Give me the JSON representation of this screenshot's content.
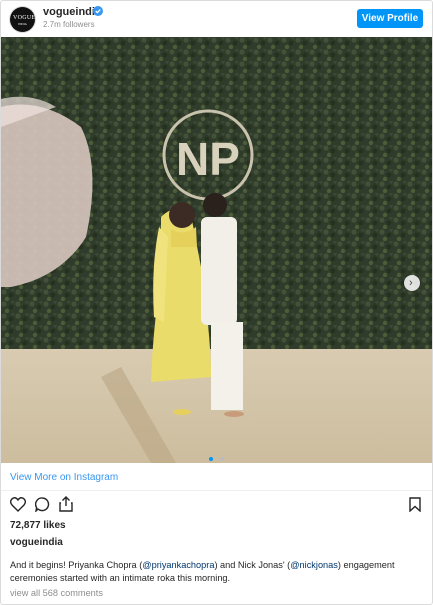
{
  "header": {
    "username": "vogueindia",
    "followers": "2.7m followers",
    "view_profile_label": "View Profile",
    "avatar_text": "VOGUE",
    "avatar_subtext": "INDIA"
  },
  "media": {
    "sign_text": "NP",
    "dots": 2,
    "active_dot": 0,
    "icons": {
      "next": "chevron-right-icon"
    }
  },
  "view_more_label": "View More on Instagram",
  "actions": {
    "icons": [
      "heart-icon",
      "comment-icon",
      "share-icon",
      "bookmark-icon"
    ]
  },
  "likes": "72,877 likes",
  "caption": {
    "username": "vogueindia",
    "text_1": "And it begins! Priyanka Chopra (",
    "mention_1": "@priyankachopra",
    "text_2": ") and Nick Jonas' (",
    "mention_2": "@nickjonas",
    "text_3": ") engagement ceremonies started with an intimate roka this morning."
  },
  "comments_label": "view all 568 comments",
  "colors": {
    "accent": "#0095f6",
    "link": "#3897f0",
    "muted": "#8e8e8e",
    "text": "#262626"
  }
}
